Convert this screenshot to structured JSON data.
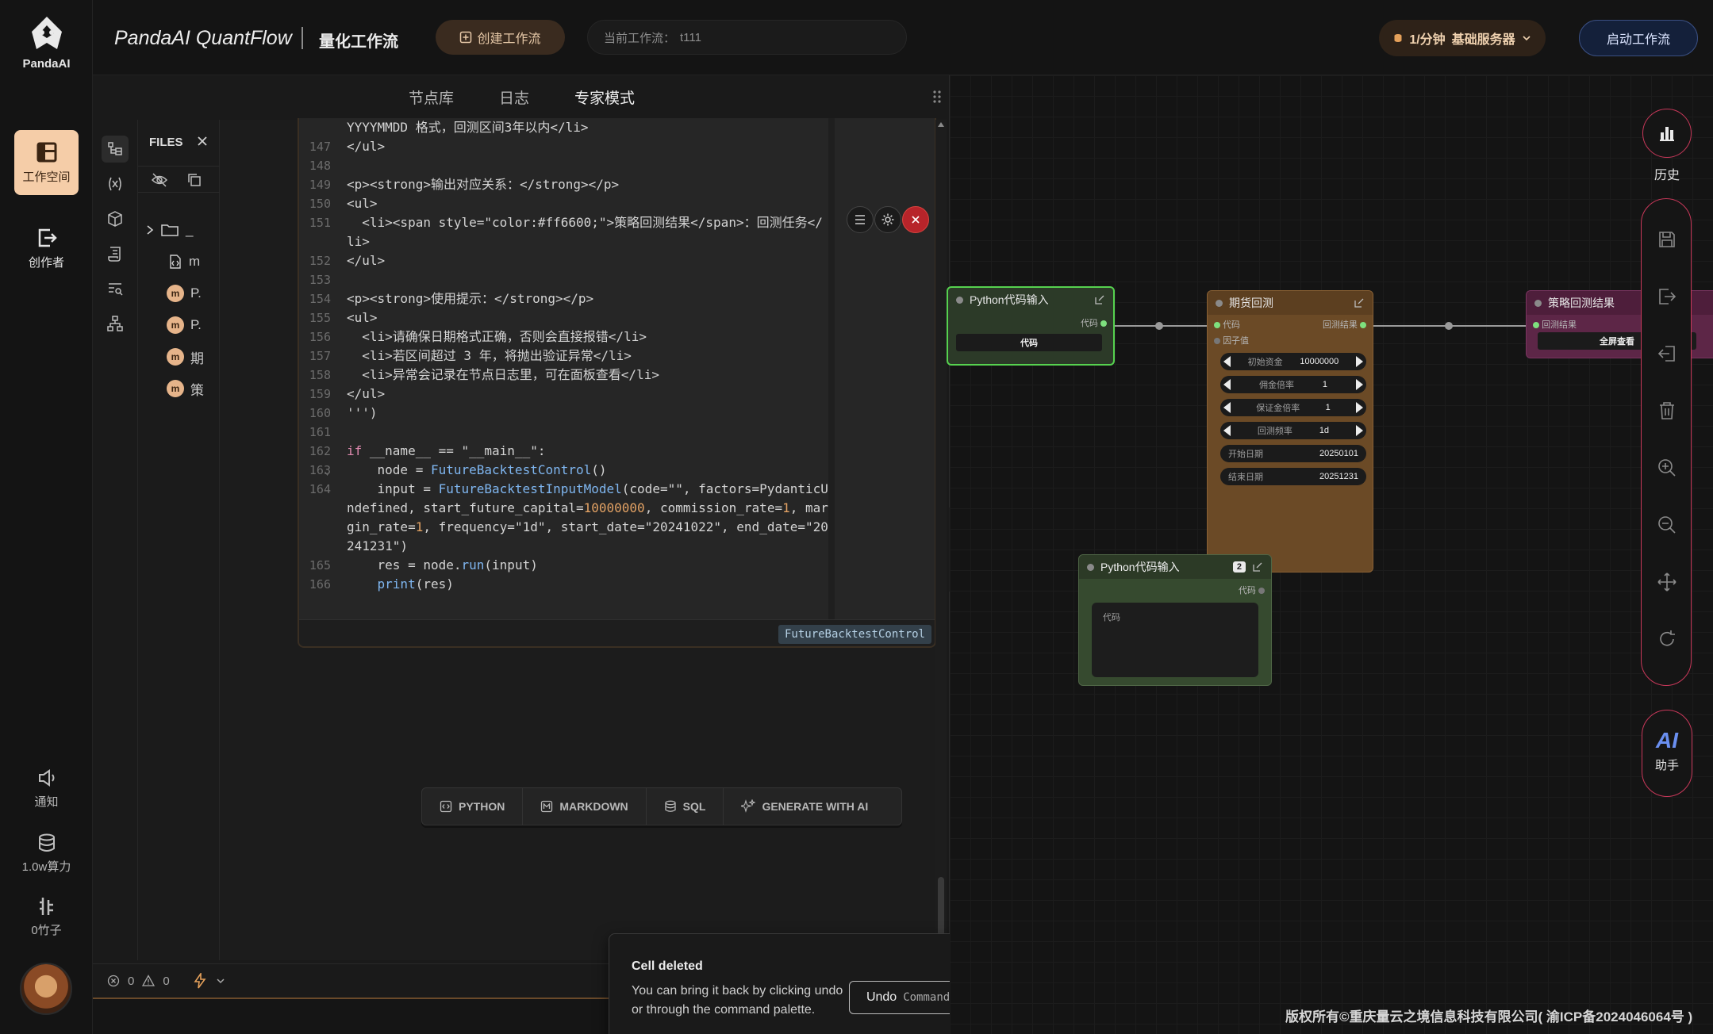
{
  "app": {
    "logo_text": "PandaAI",
    "brand": "PandaAI QuantFlow",
    "brand_sub": "量化工作流"
  },
  "leftnav": {
    "items": [
      {
        "label": "工作空间",
        "icon": "workspace-icon",
        "active": true
      },
      {
        "label": "创作者",
        "icon": "creator-icon",
        "active": false
      }
    ],
    "bottom": [
      {
        "label": "通知",
        "icon": "speaker-icon"
      },
      {
        "label": "1.0w算力",
        "icon": "database-icon"
      },
      {
        "label": "0竹子",
        "icon": "bamboo-icon"
      }
    ]
  },
  "topbar": {
    "create_label": "创建工作流",
    "current_label": "当前工作流：",
    "current_value": "t111",
    "rate": "1/分钟",
    "server": "基础服务器",
    "start_label": "启动工作流"
  },
  "panel": {
    "tabs": [
      {
        "label": "节点库",
        "active": false
      },
      {
        "label": "日志",
        "active": false
      },
      {
        "label": "专家模式",
        "active": true
      }
    ],
    "files_title": "FILES",
    "files": [
      {
        "type": "folder",
        "name": "_"
      },
      {
        "type": "file",
        "name": "m"
      },
      {
        "type": "module",
        "name": "P."
      },
      {
        "type": "module",
        "name": "P."
      },
      {
        "type": "module",
        "name": "期"
      },
      {
        "type": "module",
        "name": "策"
      }
    ],
    "cell_tag": "FutureBacktestControl",
    "add_buttons": [
      "PYTHON",
      "MARKDOWN",
      "SQL",
      "GENERATE WITH AI"
    ],
    "status": {
      "errors": "0",
      "warnings": "0"
    }
  },
  "toast": {
    "title": "Cell deleted",
    "body": "You can bring it back by clicking undo or through the command palette.",
    "button": "Undo",
    "shortcut": "Command Z"
  },
  "canvas": {
    "node_py1": {
      "title": "Python代码输入",
      "port_out": "代码",
      "button": "代码"
    },
    "node_bt": {
      "title": "期货回测",
      "in_ports": [
        "代码",
        "因子值"
      ],
      "out_port": "回测结果",
      "fields": [
        {
          "label": "初始资金",
          "value": "10000000"
        },
        {
          "label": "佣金倍率",
          "value": "1"
        },
        {
          "label": "保证金倍率",
          "value": "1"
        },
        {
          "label": "回测频率",
          "value": "1d"
        },
        {
          "label": "开始日期",
          "value": "20250101"
        },
        {
          "label": "结束日期",
          "value": "20251231"
        }
      ]
    },
    "node_res": {
      "title": "策略回测结果",
      "in_port": "回测结果",
      "button": "全屏查看"
    },
    "node_py2": {
      "title": "Python代码输入",
      "badge": "2",
      "port_out": "代码",
      "area_label": "代码"
    }
  },
  "right_tools": {
    "history_label": "历史",
    "ai_label": "AI",
    "ai_sub": "助手",
    "icons": [
      "save-icon",
      "export-icon",
      "import-icon",
      "trash-icon",
      "zoom-in-icon",
      "zoom-out-icon",
      "move-icon",
      "refresh-icon"
    ]
  },
  "footer": {
    "copyright": "版权所有©重庆量云之境信息科技有限公司( 渝ICP备2024046064号 )"
  }
}
